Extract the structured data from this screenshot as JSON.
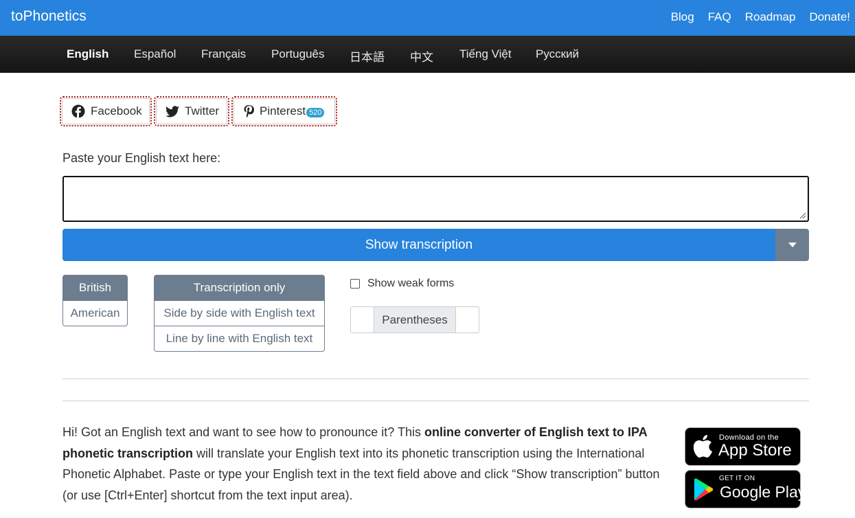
{
  "header": {
    "brand": "toPhonetics",
    "links": [
      "Blog",
      "FAQ",
      "Roadmap",
      "Donate!"
    ]
  },
  "languages": [
    {
      "label": "English",
      "active": true
    },
    {
      "label": "Español",
      "active": false
    },
    {
      "label": "Français",
      "active": false
    },
    {
      "label": "Português",
      "active": false
    },
    {
      "label": "日本語",
      "active": false
    },
    {
      "label": "中文",
      "active": false
    },
    {
      "label": "Tiếng Việt",
      "active": false
    },
    {
      "label": "Русский",
      "active": false
    }
  ],
  "share": {
    "facebook": "Facebook",
    "twitter": "Twitter",
    "pinterest": "Pinterest",
    "pinterest_count": "520"
  },
  "input": {
    "label": "Paste your English text here:",
    "value": ""
  },
  "submit": {
    "label": "Show transcription"
  },
  "accent": {
    "options": [
      "British",
      "American"
    ],
    "selected": "British"
  },
  "output_mode": {
    "options": [
      "Transcription only",
      "Side by side with English text",
      "Line by line with English text"
    ],
    "selected": "Transcription only"
  },
  "weak_forms": {
    "label": "Show weak forms",
    "checked": false
  },
  "brackets": {
    "label": "Parentheses"
  },
  "description": {
    "part1": "Hi! Got an English text and want to see how to pronounce it? This ",
    "bold": "online converter of English text to IPA phonetic transcription",
    "part2": " will translate your English text into its phonetic transcription using the International Phonetic Alphabet. Paste or type your English text in the text field above and click “Show transcription” button (or use [Ctrl+Enter] shortcut from the text input area)."
  },
  "stores": {
    "apple_small": "Download on the",
    "apple_big": "App Store",
    "google_small": "GET IT ON",
    "google_big": "Google Play"
  },
  "colors": {
    "primary": "#2783dd",
    "secondary": "#6c7d8f",
    "langbar": "#1c1c1c"
  }
}
